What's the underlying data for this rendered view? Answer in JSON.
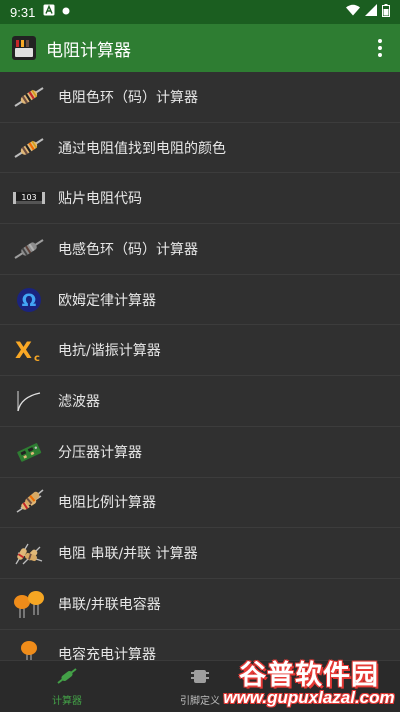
{
  "status_bar": {
    "time": "9:31"
  },
  "app_bar": {
    "title": "电阻计算器",
    "menu_icon": "more-vert-icon"
  },
  "menu": [
    {
      "label": "电阻色环（码）计算器",
      "icon": "resistor-icon"
    },
    {
      "label": "通过电阻值找到电阻的颜色",
      "icon": "resistor-icon"
    },
    {
      "label": "贴片电阻代码",
      "icon": "smd-resistor-icon",
      "icon_text": "103"
    },
    {
      "label": "电感色环（码）计算器",
      "icon": "inductor-icon"
    },
    {
      "label": "欧姆定律计算器",
      "icon": "ohm-icon",
      "icon_text": "Ω"
    },
    {
      "label": "电抗/谐振计算器",
      "icon": "reactance-icon",
      "icon_text": "X",
      "icon_sub": "c"
    },
    {
      "label": "滤波器",
      "icon": "filter-curve-icon"
    },
    {
      "label": "分压器计算器",
      "icon": "voltage-divider-icon"
    },
    {
      "label": "电阻比例计算器",
      "icon": "resistor-ratio-icon"
    },
    {
      "label": "电阻 串联/并联 计算器",
      "icon": "resistor-network-icon"
    },
    {
      "label": "串联/并联电容器",
      "icon": "capacitors-icon"
    },
    {
      "label": "电容充电计算器",
      "icon": "capacitor-icon"
    }
  ],
  "bottom_nav": [
    {
      "label": "计算器",
      "icon": "calculator-tab-icon",
      "active": true
    },
    {
      "label": "引脚定义",
      "icon": "pinout-tab-icon",
      "active": false
    }
  ],
  "watermark": {
    "main": "谷普软件园",
    "sub": "www.gupuxlazal.com"
  },
  "colors": {
    "status_bar": "#1b5e20",
    "app_bar": "#2e7d32",
    "background": "#303030",
    "active_tab": "#43a047"
  }
}
